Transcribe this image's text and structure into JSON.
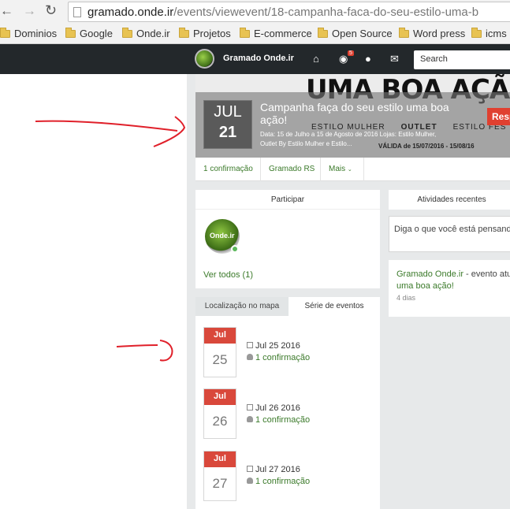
{
  "browser": {
    "url_host": "gramado.onde.ir",
    "url_path": "/events/viewevent/18-campanha-faca-do-seu-estilo-uma-b",
    "bookmarks": [
      "Dominios",
      "Google",
      "Onde.ir",
      "Projetos",
      "E-commerce",
      "Open Source",
      "Word press",
      "icms"
    ]
  },
  "site": {
    "brand": "Gramado Onde.ir",
    "notification_count": "5",
    "search_placeholder": "Search"
  },
  "event": {
    "month": "JUL",
    "day": "21",
    "title": "Campanha faça do seu estilo uma boa ação!",
    "subtitle": "Data: 15 de Julho a 15 de Agosto de 2016 Lojas: Estilo Mulher, Outlet By Estilo Mulher e Estilo...",
    "respond_label": "Resp",
    "cover_headline": "UMA BOA AÇÃO !",
    "cover_brands": [
      "ESTILO MULHER",
      "OUTLET",
      "ESTILO FES"
    ],
    "cover_validity": "VÁLIDA de 15/07/2016 - 15/08/16"
  },
  "meta": {
    "confirmations": "1 confirmação",
    "location": "Gramado RS",
    "more": "Mais"
  },
  "participate": {
    "heading": "Participar",
    "avatar_text": "Onde.ir",
    "see_all": "Ver todos (1)"
  },
  "tabs": {
    "map": "Localização no mapa",
    "series": "Série de eventos"
  },
  "series": [
    {
      "month": "Jul",
      "day": "25",
      "date": "Jul 25 2016",
      "confirm": "1 confirmação"
    },
    {
      "month": "Jul",
      "day": "26",
      "date": "Jul 26 2016",
      "confirm": "1 confirmação"
    },
    {
      "month": "Jul",
      "day": "27",
      "date": "Jul 27 2016",
      "confirm": "1 confirmação"
    }
  ],
  "activities": {
    "heading": "Atividades recentes",
    "status_placeholder": "Diga o que você está pensando",
    "item_author": "Gramado Onde.ir",
    "item_text": " - evento atual",
    "item_link": "uma boa ação!",
    "item_time": "4 dias"
  },
  "colors": {
    "nav_bg": "#23282b",
    "accent_red": "#d9483b",
    "link_green": "#3b7a2a",
    "annotation_red": "#e0202a"
  }
}
